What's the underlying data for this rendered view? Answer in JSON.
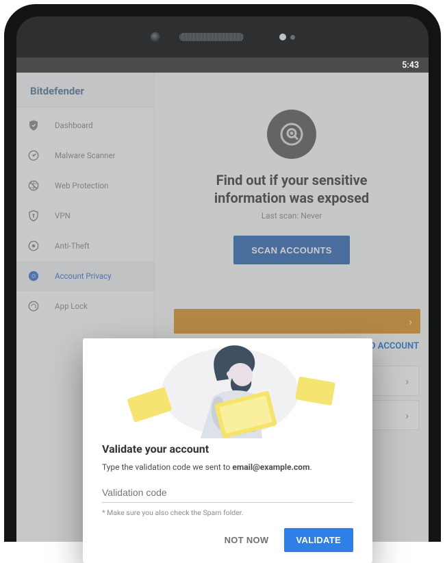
{
  "status": {
    "time": "5:43"
  },
  "brand": "Bitdefender",
  "sidebar": {
    "items": [
      {
        "label": "Dashboard"
      },
      {
        "label": "Malware Scanner"
      },
      {
        "label": "Web Protection"
      },
      {
        "label": "VPN"
      },
      {
        "label": "Anti-Theft"
      },
      {
        "label": "Account Privacy"
      },
      {
        "label": "App Lock"
      }
    ]
  },
  "main": {
    "title_line1": "Find out if your sensitive",
    "title_line2": "information was exposed",
    "last_scan": "Last scan: Never",
    "scan_btn": "SCAN ACCOUNTS",
    "add_account": "ADD ACCOUNT"
  },
  "modal": {
    "title": "Validate your account",
    "desc_prefix": "Type the validation code we sent to ",
    "email": "email@example.com",
    "desc_suffix": ".",
    "placeholder": "Validation code",
    "hint": "* Make sure you also check the Spam folder.",
    "not_now": "NOT NOW",
    "validate": "VALIDATE"
  }
}
